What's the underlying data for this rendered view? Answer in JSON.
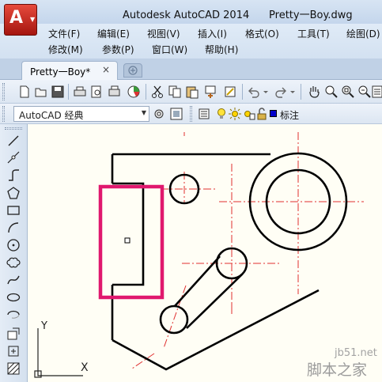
{
  "window": {
    "title": "Autodesk AutoCAD 2014      Pretty一Boy.dwg",
    "app_button_logo": "A",
    "accent_color": "#c4271b"
  },
  "menubar": {
    "row1": [
      "文件(F)",
      "编辑(E)",
      "视图(V)",
      "插入(I)",
      "格式(O)",
      "工具(T)",
      "绘图(D)"
    ],
    "row2": [
      "修改(M)",
      "参数(P)",
      "窗口(W)",
      "帮助(H)"
    ]
  },
  "tabs": {
    "document_tab": "Pretty一Boy*",
    "close_glyph": "×"
  },
  "toolbar_icons": [
    "new-icon",
    "open-icon",
    "save-icon",
    "print-icon",
    "print-preview-icon",
    "publish-icon",
    "plot-icon",
    "cut-icon",
    "copy-icon",
    "paste-icon",
    "match-properties-icon",
    "block-editor-icon",
    "undo-icon",
    "redo-icon",
    "pan-icon",
    "zoom-realtime-icon",
    "zoom-window-icon",
    "zoom-previous-icon",
    "properties-icon"
  ],
  "workspace": {
    "selected": "AutoCAD 经典",
    "layer_name": "标注",
    "layer_color": "#0000cc"
  },
  "draw_tools": [
    "line-icon",
    "construction-line-icon",
    "polyline-icon",
    "polygon-icon",
    "rectangle-icon",
    "arc-icon",
    "circle-icon",
    "revision-cloud-icon",
    "spline-icon",
    "ellipse-icon",
    "ellipse-arc-icon",
    "insert-block-icon",
    "make-block-icon"
  ],
  "canvas": {
    "ucs_x": "X",
    "ucs_y": "Y",
    "highlight_color": "#e0186e",
    "centerline_color": "#e03030"
  },
  "watermark": {
    "site": "jb51.net",
    "name": "脚本之家"
  }
}
